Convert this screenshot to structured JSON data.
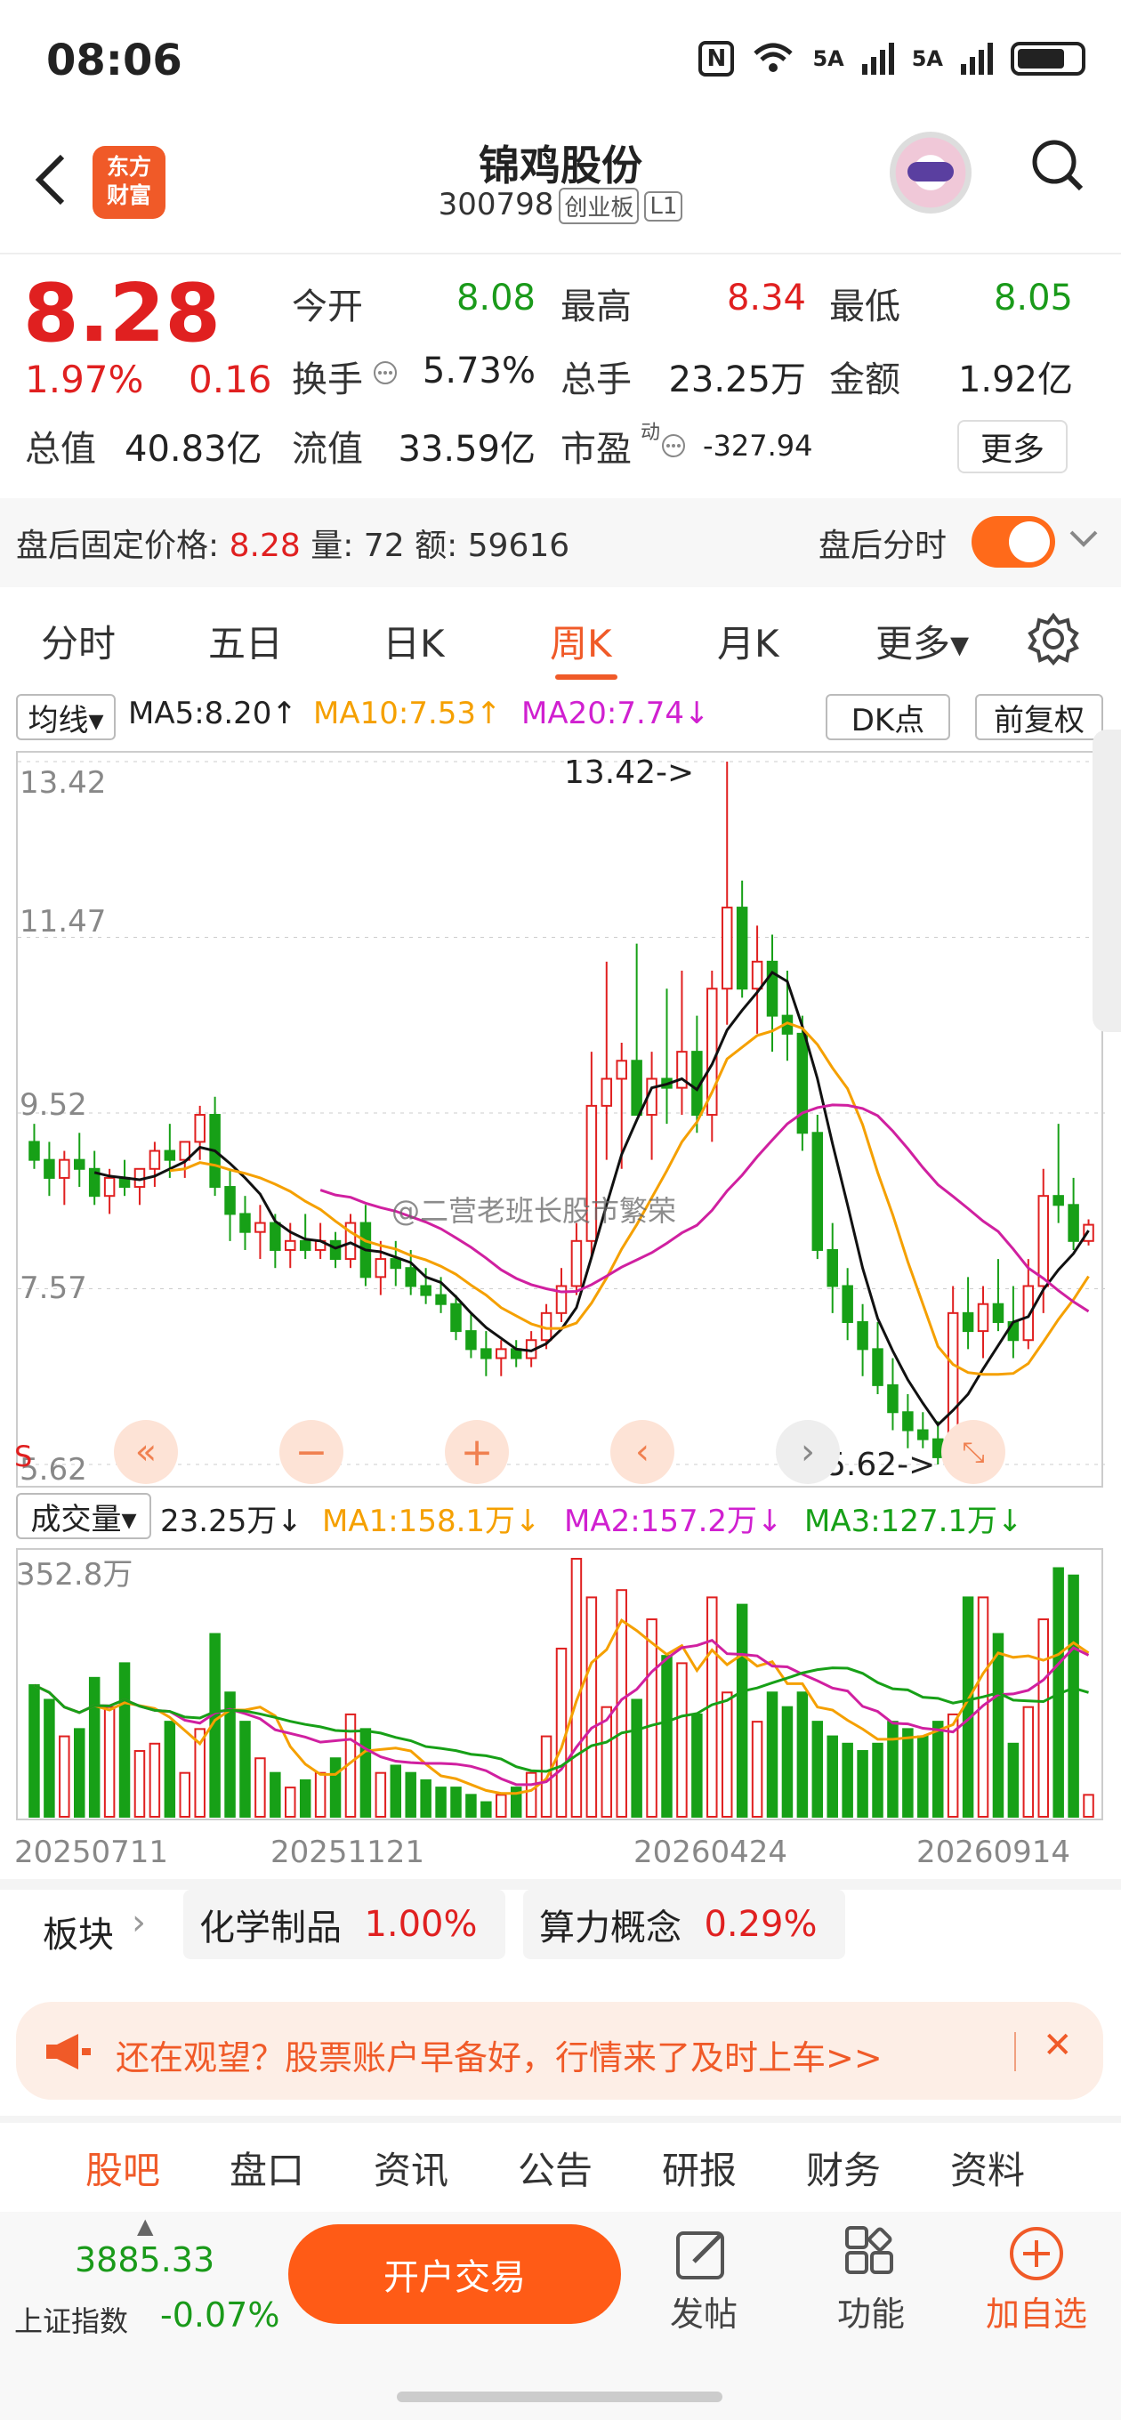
{
  "status_bar": {
    "time": "08:06",
    "nfc": "N",
    "sig1": "5A",
    "sig2": "5A"
  },
  "header": {
    "logo_line1": "东方",
    "logo_line2": "财富",
    "name": "锦鸡股份",
    "code": "300798",
    "board": "创业板",
    "level": "L1"
  },
  "quote": {
    "price": "8.28",
    "pct": "1.97%",
    "chg": "0.16",
    "open_label": "今开",
    "open": "8.08",
    "high_label": "最高",
    "high": "8.34",
    "low_label": "最低",
    "low": "8.05",
    "turnover_label": "换手",
    "turnover": "5.73%",
    "volume_label": "总手",
    "volume": "23.25万",
    "amount_label": "金额",
    "amount": "1.92亿",
    "mktcap_label": "总值",
    "mktcap": "40.83亿",
    "float_label": "流值",
    "float": "33.59亿",
    "pe_label": "市盈",
    "pe_sup": "动",
    "pe": "-327.94",
    "more": "更多"
  },
  "after_hours": {
    "label": "盘后固定价格:",
    "price": "8.28",
    "vol_label": "量:",
    "vol": "72",
    "amt_label": "额:",
    "amt": "59616",
    "toggle_label": "盘后分时"
  },
  "tabs": [
    "分时",
    "五日",
    "日K",
    "周K",
    "月K",
    "更多▾"
  ],
  "ma_bar": {
    "selector": "均线▾",
    "ma5": "MA5:8.20↑",
    "ma10": "MA10:7.53↑",
    "ma20": "MA20:7.74↓",
    "dk": "DK点",
    "adj": "前复权"
  },
  "price_axis": {
    "p1": "13.42",
    "p2": "11.47",
    "p3": "9.52",
    "p4": "7.57",
    "p5": "5.62",
    "high_mark": "13.42->",
    "low_mark": "5.62->",
    "s_mark": "S"
  },
  "watermark": "@二营老班长股市繁荣",
  "vol_bar": {
    "selector": "成交量▾",
    "vol": "23.25万↓",
    "ma1": "MA1:158.1万↓",
    "ma2": "MA2:157.2万↓",
    "ma3": "MA3:127.1万↓",
    "max": "352.8万"
  },
  "dates": [
    "20250711",
    "20251121",
    "20260424",
    "20260914"
  ],
  "sectors": {
    "label": "板块",
    "s1_name": "化学制品",
    "s1_pct": "1.00%",
    "s2_name": "算力概念",
    "s2_pct": "0.29%"
  },
  "banner": {
    "text": "还在观望？股票账户早备好，行情来了及时上车>>"
  },
  "bottom_tabs": [
    "股吧",
    "盘口",
    "资讯",
    "公告",
    "研报",
    "财务",
    "资料"
  ],
  "footer": {
    "index_value": "3885.33",
    "index_name": "上证指数",
    "index_pct": "-0.07%",
    "open_account": "开户交易",
    "post": "发帖",
    "func": "功能",
    "add": "加自选"
  },
  "colors": {
    "up": "#e02020",
    "down": "#17a017",
    "accent": "#f05a28",
    "ma5": "#111111",
    "ma10": "#f5a000",
    "ma20": "#d020a0"
  },
  "chart_data": {
    "type": "candlestick",
    "title": "周K",
    "ylim": [
      5.62,
      13.42
    ],
    "candles": [
      [
        9.2,
        9.4,
        8.9,
        9.0
      ],
      [
        9.0,
        9.2,
        8.6,
        8.8
      ],
      [
        8.8,
        9.1,
        8.5,
        9.0
      ],
      [
        9.0,
        9.3,
        8.7,
        8.9
      ],
      [
        8.9,
        9.1,
        8.5,
        8.6
      ],
      [
        8.6,
        8.9,
        8.4,
        8.8
      ],
      [
        8.8,
        9.0,
        8.6,
        8.7
      ],
      [
        8.7,
        8.9,
        8.5,
        8.9
      ],
      [
        8.9,
        9.2,
        8.7,
        9.1
      ],
      [
        9.1,
        9.4,
        8.8,
        9.0
      ],
      [
        9.0,
        9.2,
        8.8,
        9.2
      ],
      [
        9.2,
        9.6,
        9.0,
        9.5
      ],
      [
        9.5,
        9.7,
        8.6,
        8.7
      ],
      [
        8.7,
        8.9,
        8.1,
        8.4
      ],
      [
        8.4,
        8.6,
        8.0,
        8.2
      ],
      [
        8.2,
        8.5,
        7.9,
        8.3
      ],
      [
        8.3,
        8.4,
        7.8,
        8.0
      ],
      [
        8.0,
        8.3,
        7.8,
        8.1
      ],
      [
        8.1,
        8.4,
        7.9,
        8.0
      ],
      [
        8.0,
        8.3,
        7.9,
        8.1
      ],
      [
        8.1,
        8.2,
        7.8,
        7.9
      ],
      [
        7.9,
        8.4,
        7.8,
        8.3
      ],
      [
        8.3,
        8.5,
        7.6,
        7.7
      ],
      [
        7.7,
        8.1,
        7.5,
        7.9
      ],
      [
        7.9,
        8.1,
        7.6,
        7.8
      ],
      [
        7.8,
        8.0,
        7.5,
        7.6
      ],
      [
        7.6,
        7.8,
        7.4,
        7.5
      ],
      [
        7.5,
        7.7,
        7.3,
        7.4
      ],
      [
        7.4,
        7.5,
        7.0,
        7.1
      ],
      [
        7.1,
        7.3,
        6.8,
        6.9
      ],
      [
        6.9,
        7.1,
        6.6,
        6.8
      ],
      [
        6.8,
        7.0,
        6.6,
        6.9
      ],
      [
        6.9,
        7.0,
        6.7,
        6.8
      ],
      [
        6.8,
        7.1,
        6.7,
        7.0
      ],
      [
        7.0,
        7.4,
        6.9,
        7.3
      ],
      [
        7.3,
        7.8,
        7.2,
        7.6
      ],
      [
        7.6,
        8.3,
        7.5,
        8.1
      ],
      [
        8.1,
        10.2,
        7.9,
        9.6
      ],
      [
        9.6,
        11.2,
        9.0,
        9.9
      ],
      [
        9.9,
        10.3,
        8.9,
        10.1
      ],
      [
        10.1,
        11.4,
        9.6,
        9.5
      ],
      [
        9.5,
        10.2,
        9.0,
        9.9
      ],
      [
        9.9,
        10.9,
        9.4,
        9.8
      ],
      [
        9.8,
        11.1,
        9.5,
        10.2
      ],
      [
        10.2,
        10.6,
        9.3,
        9.5
      ],
      [
        9.5,
        11.1,
        9.2,
        10.9
      ],
      [
        10.9,
        13.42,
        10.5,
        11.8
      ],
      [
        11.8,
        12.1,
        10.8,
        10.9
      ],
      [
        10.9,
        11.6,
        10.4,
        11.2
      ],
      [
        11.2,
        11.5,
        10.2,
        10.6
      ],
      [
        10.6,
        11.1,
        10.1,
        10.4
      ],
      [
        10.4,
        10.6,
        9.1,
        9.3
      ],
      [
        9.3,
        9.5,
        7.9,
        8.0
      ],
      [
        8.0,
        8.3,
        7.3,
        7.6
      ],
      [
        7.6,
        7.8,
        7.0,
        7.2
      ],
      [
        7.2,
        7.4,
        6.6,
        6.9
      ],
      [
        6.9,
        7.2,
        6.4,
        6.5
      ],
      [
        6.5,
        6.8,
        6.0,
        6.2
      ],
      [
        6.2,
        6.4,
        5.8,
        6.0
      ],
      [
        6.0,
        6.2,
        5.8,
        5.9
      ],
      [
        5.9,
        6.1,
        5.62,
        5.7
      ],
      [
        5.7,
        7.6,
        5.62,
        7.3
      ],
      [
        7.3,
        7.7,
        6.9,
        7.1
      ],
      [
        7.1,
        7.6,
        6.8,
        7.4
      ],
      [
        7.4,
        7.9,
        7.1,
        7.2
      ],
      [
        7.2,
        7.6,
        6.8,
        7.0
      ],
      [
        7.0,
        7.9,
        6.9,
        7.6
      ],
      [
        7.6,
        8.9,
        7.3,
        8.6
      ],
      [
        8.6,
        9.4,
        8.3,
        8.5
      ],
      [
        8.5,
        8.8,
        8.0,
        8.1
      ],
      [
        8.1,
        8.34,
        8.05,
        8.28
      ]
    ],
    "volume": [
      180,
      160,
      110,
      120,
      190,
      150,
      210,
      90,
      100,
      130,
      60,
      120,
      250,
      170,
      130,
      80,
      60,
      40,
      50,
      60,
      80,
      140,
      120,
      60,
      70,
      60,
      50,
      40,
      40,
      30,
      20,
      30,
      40,
      60,
      110,
      230,
      352.8,
      300,
      150,
      310,
      160,
      270,
      220,
      210,
      140,
      300,
      170,
      290,
      130,
      170,
      150,
      170,
      130,
      110,
      100,
      90,
      100,
      130,
      120,
      110,
      130,
      140,
      300,
      300,
      250,
      100,
      150,
      270,
      340,
      330,
      30
    ],
    "ma5": [
      9.35,
      8.9
    ],
    "y_ticks": [
      13.42,
      11.47,
      9.52,
      7.57,
      5.62
    ]
  }
}
